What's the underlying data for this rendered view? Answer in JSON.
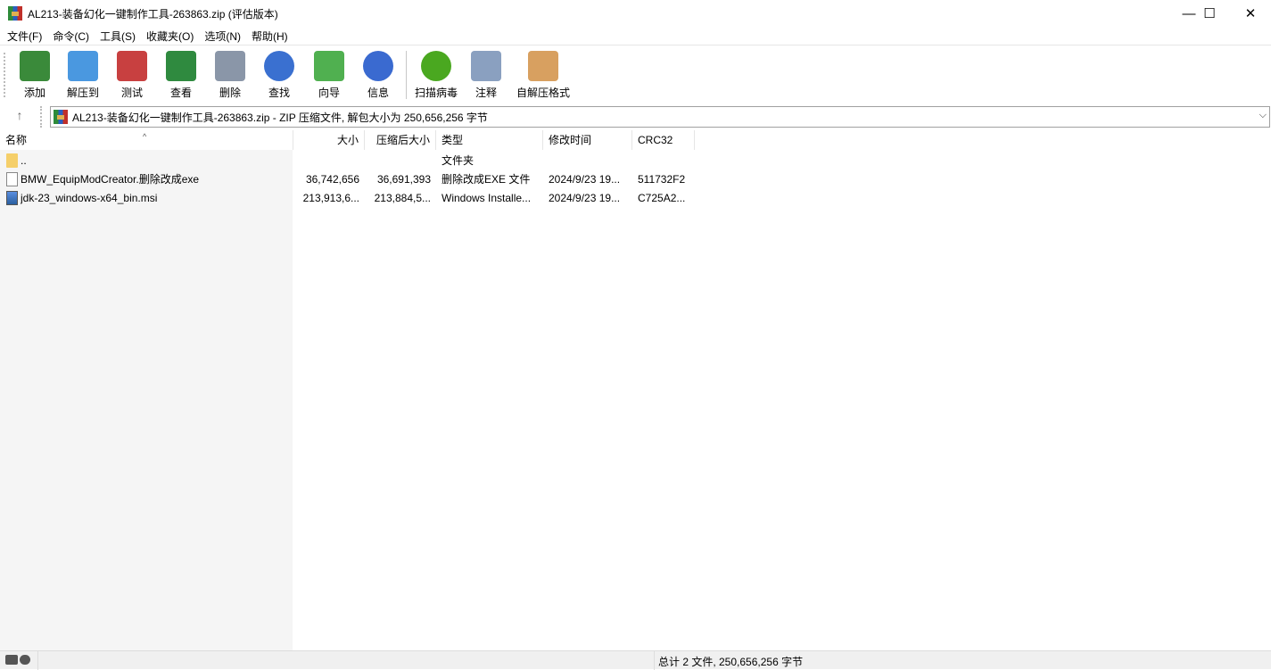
{
  "window": {
    "title": "AL213-装备幻化一键制作工具-263863.zip (评估版本)",
    "minimize": "—",
    "maximize": "☐",
    "close": "✕"
  },
  "menu": [
    "文件(F)",
    "命令(C)",
    "工具(S)",
    "收藏夹(O)",
    "选项(N)",
    "帮助(H)"
  ],
  "toolbar": [
    {
      "label": "添加",
      "icon": "add-archive-icon",
      "color": "#3a8a3a"
    },
    {
      "label": "解压到",
      "icon": "extract-folder-icon",
      "color": "#4a98e0"
    },
    {
      "label": "测试",
      "icon": "test-clipboard-icon",
      "color": "#c84040"
    },
    {
      "label": "查看",
      "icon": "view-book-icon",
      "color": "#2f8a3f"
    },
    {
      "label": "删除",
      "icon": "delete-trash-icon",
      "color": "#8a96a8"
    },
    {
      "label": "查找",
      "icon": "find-magnifier-icon",
      "color": "#3a70d0"
    },
    {
      "label": "向导",
      "icon": "wizard-wand-icon",
      "color": "#50b050"
    },
    {
      "label": "信息",
      "icon": "info-icon",
      "color": "#3a6ad0"
    },
    {
      "label": "扫描病毒",
      "icon": "virus-scan-icon",
      "color": "#4aa820"
    },
    {
      "label": "注释",
      "icon": "comment-icon",
      "color": "#8aa0c0"
    },
    {
      "label": "自解压格式",
      "icon": "sfx-box-icon",
      "color": "#d8a060"
    }
  ],
  "address": {
    "up": "↑",
    "text": "AL213-装备幻化一键制作工具-263863.zip - ZIP 压缩文件, 解包大小为 250,656,256 字节",
    "chevron": "⌵"
  },
  "columns": {
    "name": "名称",
    "size": "大小",
    "packed": "压缩后大小",
    "type": "类型",
    "modified": "修改时间",
    "crc": "CRC32",
    "sort": "^"
  },
  "rows": [
    {
      "name": "..",
      "size": "",
      "packed": "",
      "type": "文件夹",
      "modified": "",
      "crc": "",
      "icon": "folder"
    },
    {
      "name": "BMW_EquipModCreator.删除改成exe",
      "size": "36,742,656",
      "packed": "36,691,393",
      "type": "删除改成EXE 文件",
      "modified": "2024/9/23 19...",
      "crc": "511732F2",
      "icon": "file"
    },
    {
      "name": "jdk-23_windows-x64_bin.msi",
      "size": "213,913,6...",
      "packed": "213,884,5...",
      "type": "Windows Installe...",
      "modified": "2024/9/23 19...",
      "crc": "C725A2...",
      "icon": "msi"
    }
  ],
  "status": {
    "text": "总计 2 文件, 250,656,256 字节"
  }
}
